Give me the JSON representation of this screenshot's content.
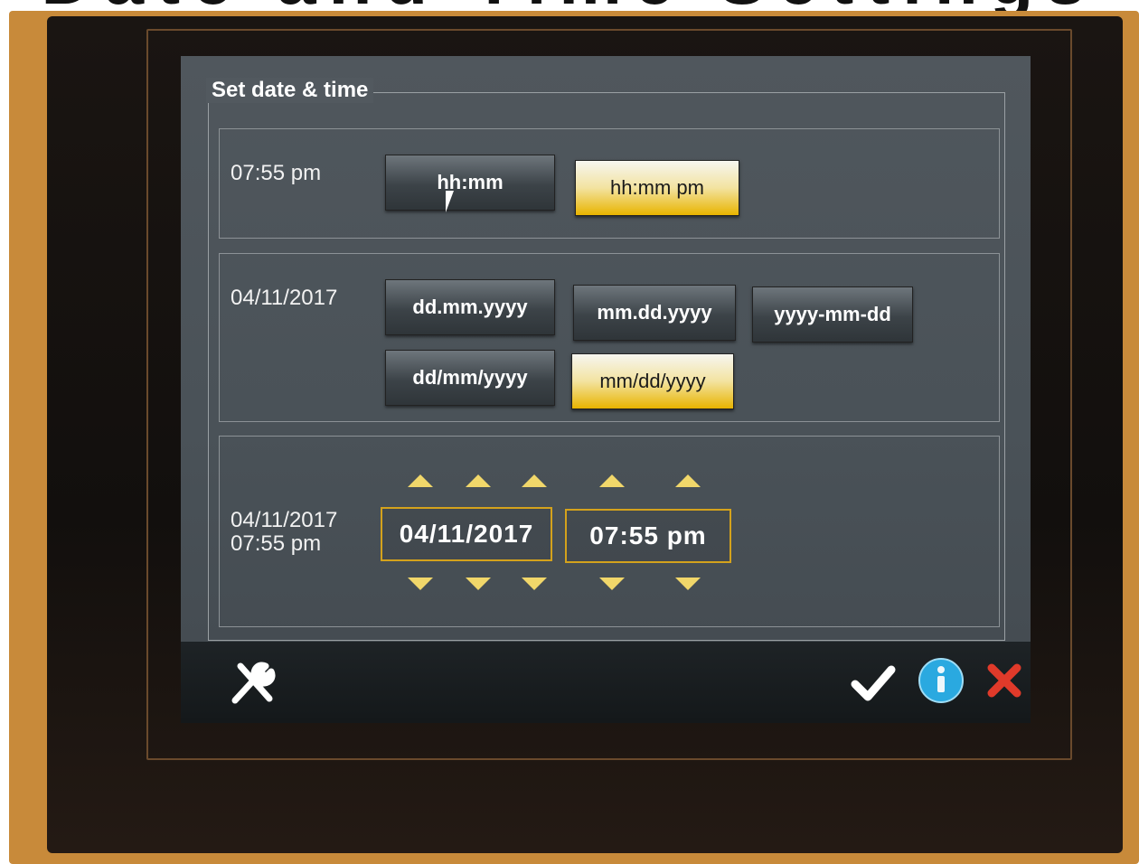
{
  "heading": "Date and Time Settings",
  "panel": {
    "title": "Set date & time"
  },
  "time_format": {
    "current": "07:55 pm",
    "options": [
      {
        "label": "hh:mm",
        "selected": false
      },
      {
        "label": "hh:mm pm",
        "selected": true
      }
    ]
  },
  "date_format": {
    "current": "04/11/2017",
    "options": [
      {
        "label": "dd.mm.yyyy",
        "selected": false
      },
      {
        "label": "mm.dd.yyyy",
        "selected": false
      },
      {
        "label": "yyyy-mm-dd",
        "selected": false
      },
      {
        "label": "dd/mm/yyyy",
        "selected": false
      },
      {
        "label": "mm/dd/yyyy",
        "selected": true
      }
    ]
  },
  "datetime_edit": {
    "current_date": "04/11/2017",
    "current_time": "07:55 pm",
    "date_value": "04/11/2017",
    "time_value": "07:55 pm"
  },
  "footer": {
    "tools_icon": "tools-icon",
    "confirm_icon": "checkmark-icon",
    "info_icon": "info-icon",
    "cancel_icon": "close-icon"
  },
  "colors": {
    "accent": "#e8b400",
    "cancel": "#e03a2a",
    "info": "#2aa9e0"
  }
}
